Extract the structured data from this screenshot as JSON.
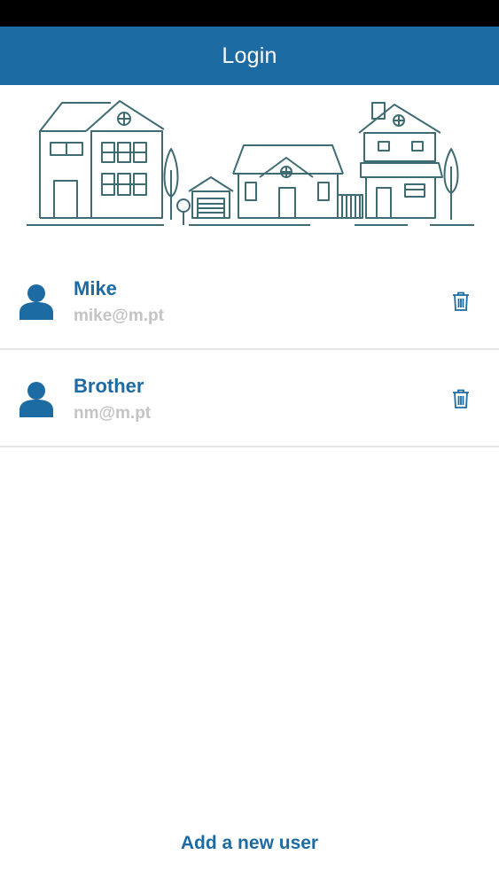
{
  "header": {
    "title": "Login"
  },
  "users": [
    {
      "name": "Mike",
      "email": "mike@m.pt"
    },
    {
      "name": "Brother",
      "email": "nm@m.pt"
    }
  ],
  "footer": {
    "add_user_label": "Add a new user"
  },
  "colors": {
    "primary": "#1c6ba3",
    "illustration_stroke": "#3f6b73",
    "email_gray": "#c4c4c4",
    "divider": "#e6e6e6"
  }
}
